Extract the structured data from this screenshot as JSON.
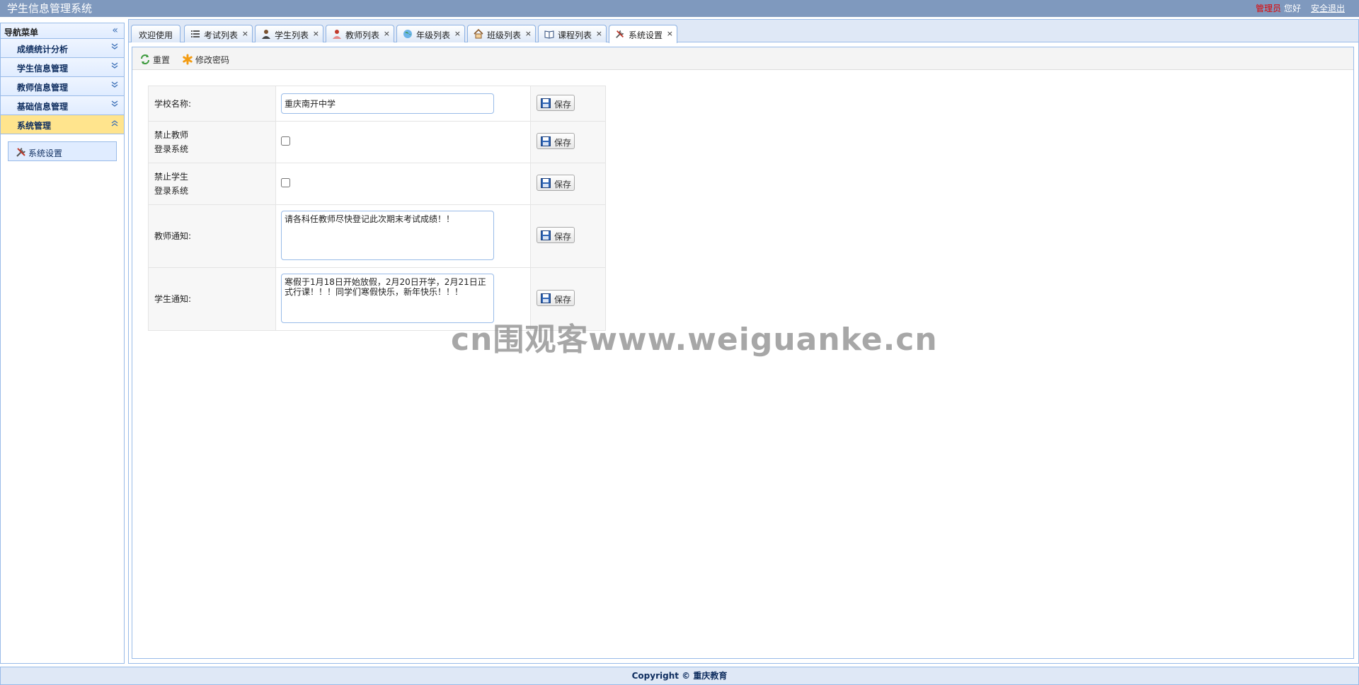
{
  "header": {
    "title": "学生信息管理系统",
    "user_role": "管理员",
    "greeting": "您好",
    "logout": "安全退出"
  },
  "nav": {
    "title": "导航菜单",
    "groups": [
      {
        "label": "成绩统计分析",
        "active": false
      },
      {
        "label": "学生信息管理",
        "active": false
      },
      {
        "label": "教师信息管理",
        "active": false
      },
      {
        "label": "基础信息管理",
        "active": false
      },
      {
        "label": "系统管理",
        "active": true
      }
    ],
    "items": [
      {
        "label": "系统设置",
        "icon": "tools-icon"
      }
    ]
  },
  "tabs": [
    {
      "label": "欢迎使用",
      "icon": null,
      "closable": false,
      "active": false
    },
    {
      "label": "考试列表",
      "icon": "list-icon",
      "closable": true,
      "active": false
    },
    {
      "label": "学生列表",
      "icon": "student-icon",
      "closable": true,
      "active": false
    },
    {
      "label": "教师列表",
      "icon": "teacher-icon",
      "closable": true,
      "active": false
    },
    {
      "label": "年级列表",
      "icon": "globe-icon",
      "closable": true,
      "active": false
    },
    {
      "label": "班级列表",
      "icon": "house-icon",
      "closable": true,
      "active": false
    },
    {
      "label": "课程列表",
      "icon": "book-icon",
      "closable": true,
      "active": false
    },
    {
      "label": "系统设置",
      "icon": "tools-icon",
      "closable": true,
      "active": true
    }
  ],
  "toolbar": {
    "reset_label": "重置",
    "change_password_label": "修改密码"
  },
  "settings": {
    "school_name_label": "学校名称:",
    "school_name_value": "重庆南开中学",
    "forbid_teacher_label_1": "禁止教师",
    "forbid_teacher_label_2": "登录系统",
    "forbid_teacher_checked": false,
    "forbid_student_label_1": "禁止学生",
    "forbid_student_label_2": "登录系统",
    "forbid_student_checked": false,
    "teacher_notice_label": "教师通知:",
    "teacher_notice_value": "请各科任教师尽快登记此次期末考试成绩！！",
    "student_notice_label": "学生通知:",
    "student_notice_value": "寒假于1月18日开始放假，2月20日开学，2月21日正式行课！！！同学们寒假快乐，新年快乐！！！",
    "save_label": "保存"
  },
  "watermark": "cn围观客www.weiguanke.cn",
  "footer": {
    "copyright": "Copyright © 重庆教育"
  },
  "colors": {
    "header_bg": "#7f99be",
    "panel_border": "#99bbe8",
    "active_nav_bg": "#ffe48d",
    "role_text": "#e00000"
  }
}
